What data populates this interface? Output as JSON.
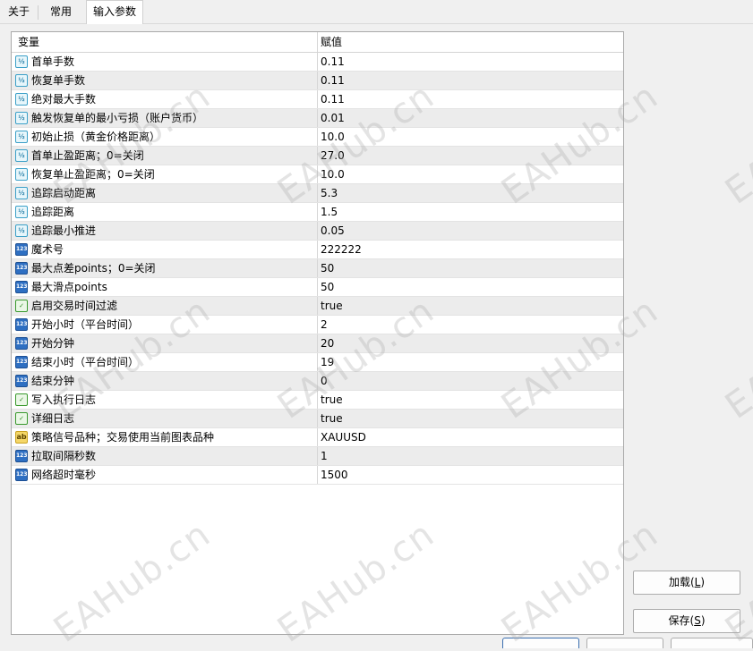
{
  "tabs": [
    {
      "label": "关于",
      "active": false
    },
    {
      "label": "常用",
      "active": false
    },
    {
      "label": "输入参数",
      "active": true
    }
  ],
  "table": {
    "headers": {
      "name": "变量",
      "value": "赋值"
    },
    "rows": [
      {
        "type": "double",
        "name": "首单手数",
        "value": "0.11"
      },
      {
        "type": "double",
        "name": "恢复单手数",
        "value": "0.11"
      },
      {
        "type": "double",
        "name": "绝对最大手数",
        "value": "0.11"
      },
      {
        "type": "double",
        "name": "触发恢复单的最小亏损（账户货币）",
        "value": "0.01"
      },
      {
        "type": "double",
        "name": "初始止损（黄金价格距离）",
        "value": "10.0"
      },
      {
        "type": "double",
        "name": "首单止盈距离；0=关闭",
        "value": "27.0"
      },
      {
        "type": "double",
        "name": "恢复单止盈距离；0=关闭",
        "value": "10.0"
      },
      {
        "type": "double",
        "name": "追踪启动距离",
        "value": "5.3"
      },
      {
        "type": "double",
        "name": "追踪距离",
        "value": "1.5"
      },
      {
        "type": "double",
        "name": "追踪最小推进",
        "value": "0.05"
      },
      {
        "type": "int",
        "name": "魔术号",
        "value": "222222"
      },
      {
        "type": "int",
        "name": "最大点差points；0=关闭",
        "value": "50"
      },
      {
        "type": "int",
        "name": "最大滑点points",
        "value": "50"
      },
      {
        "type": "bool",
        "name": "启用交易时间过滤",
        "value": "true"
      },
      {
        "type": "int",
        "name": "开始小时（平台时间）",
        "value": "2"
      },
      {
        "type": "int",
        "name": "开始分钟",
        "value": "20"
      },
      {
        "type": "int",
        "name": "结束小时（平台时间）",
        "value": "19"
      },
      {
        "type": "int",
        "name": "结束分钟",
        "value": "0"
      },
      {
        "type": "bool",
        "name": "写入执行日志",
        "value": "true"
      },
      {
        "type": "bool",
        "name": "详细日志",
        "value": "true"
      },
      {
        "type": "string",
        "name": "策略信号品种；交易使用当前图表品种",
        "value": "XAUUSD"
      },
      {
        "type": "int",
        "name": "拉取间隔秒数",
        "value": "1"
      },
      {
        "type": "int",
        "name": "网络超时毫秒",
        "value": "1500"
      }
    ]
  },
  "icons": {
    "double": "½",
    "int": "123",
    "bool": "✓",
    "string": "ab"
  },
  "buttons": {
    "load": {
      "label": "加载(",
      "key": "L",
      "suffix": ")"
    },
    "save": {
      "label": "保存(",
      "key": "S",
      "suffix": ")"
    }
  },
  "watermark": "EAHub.cn"
}
